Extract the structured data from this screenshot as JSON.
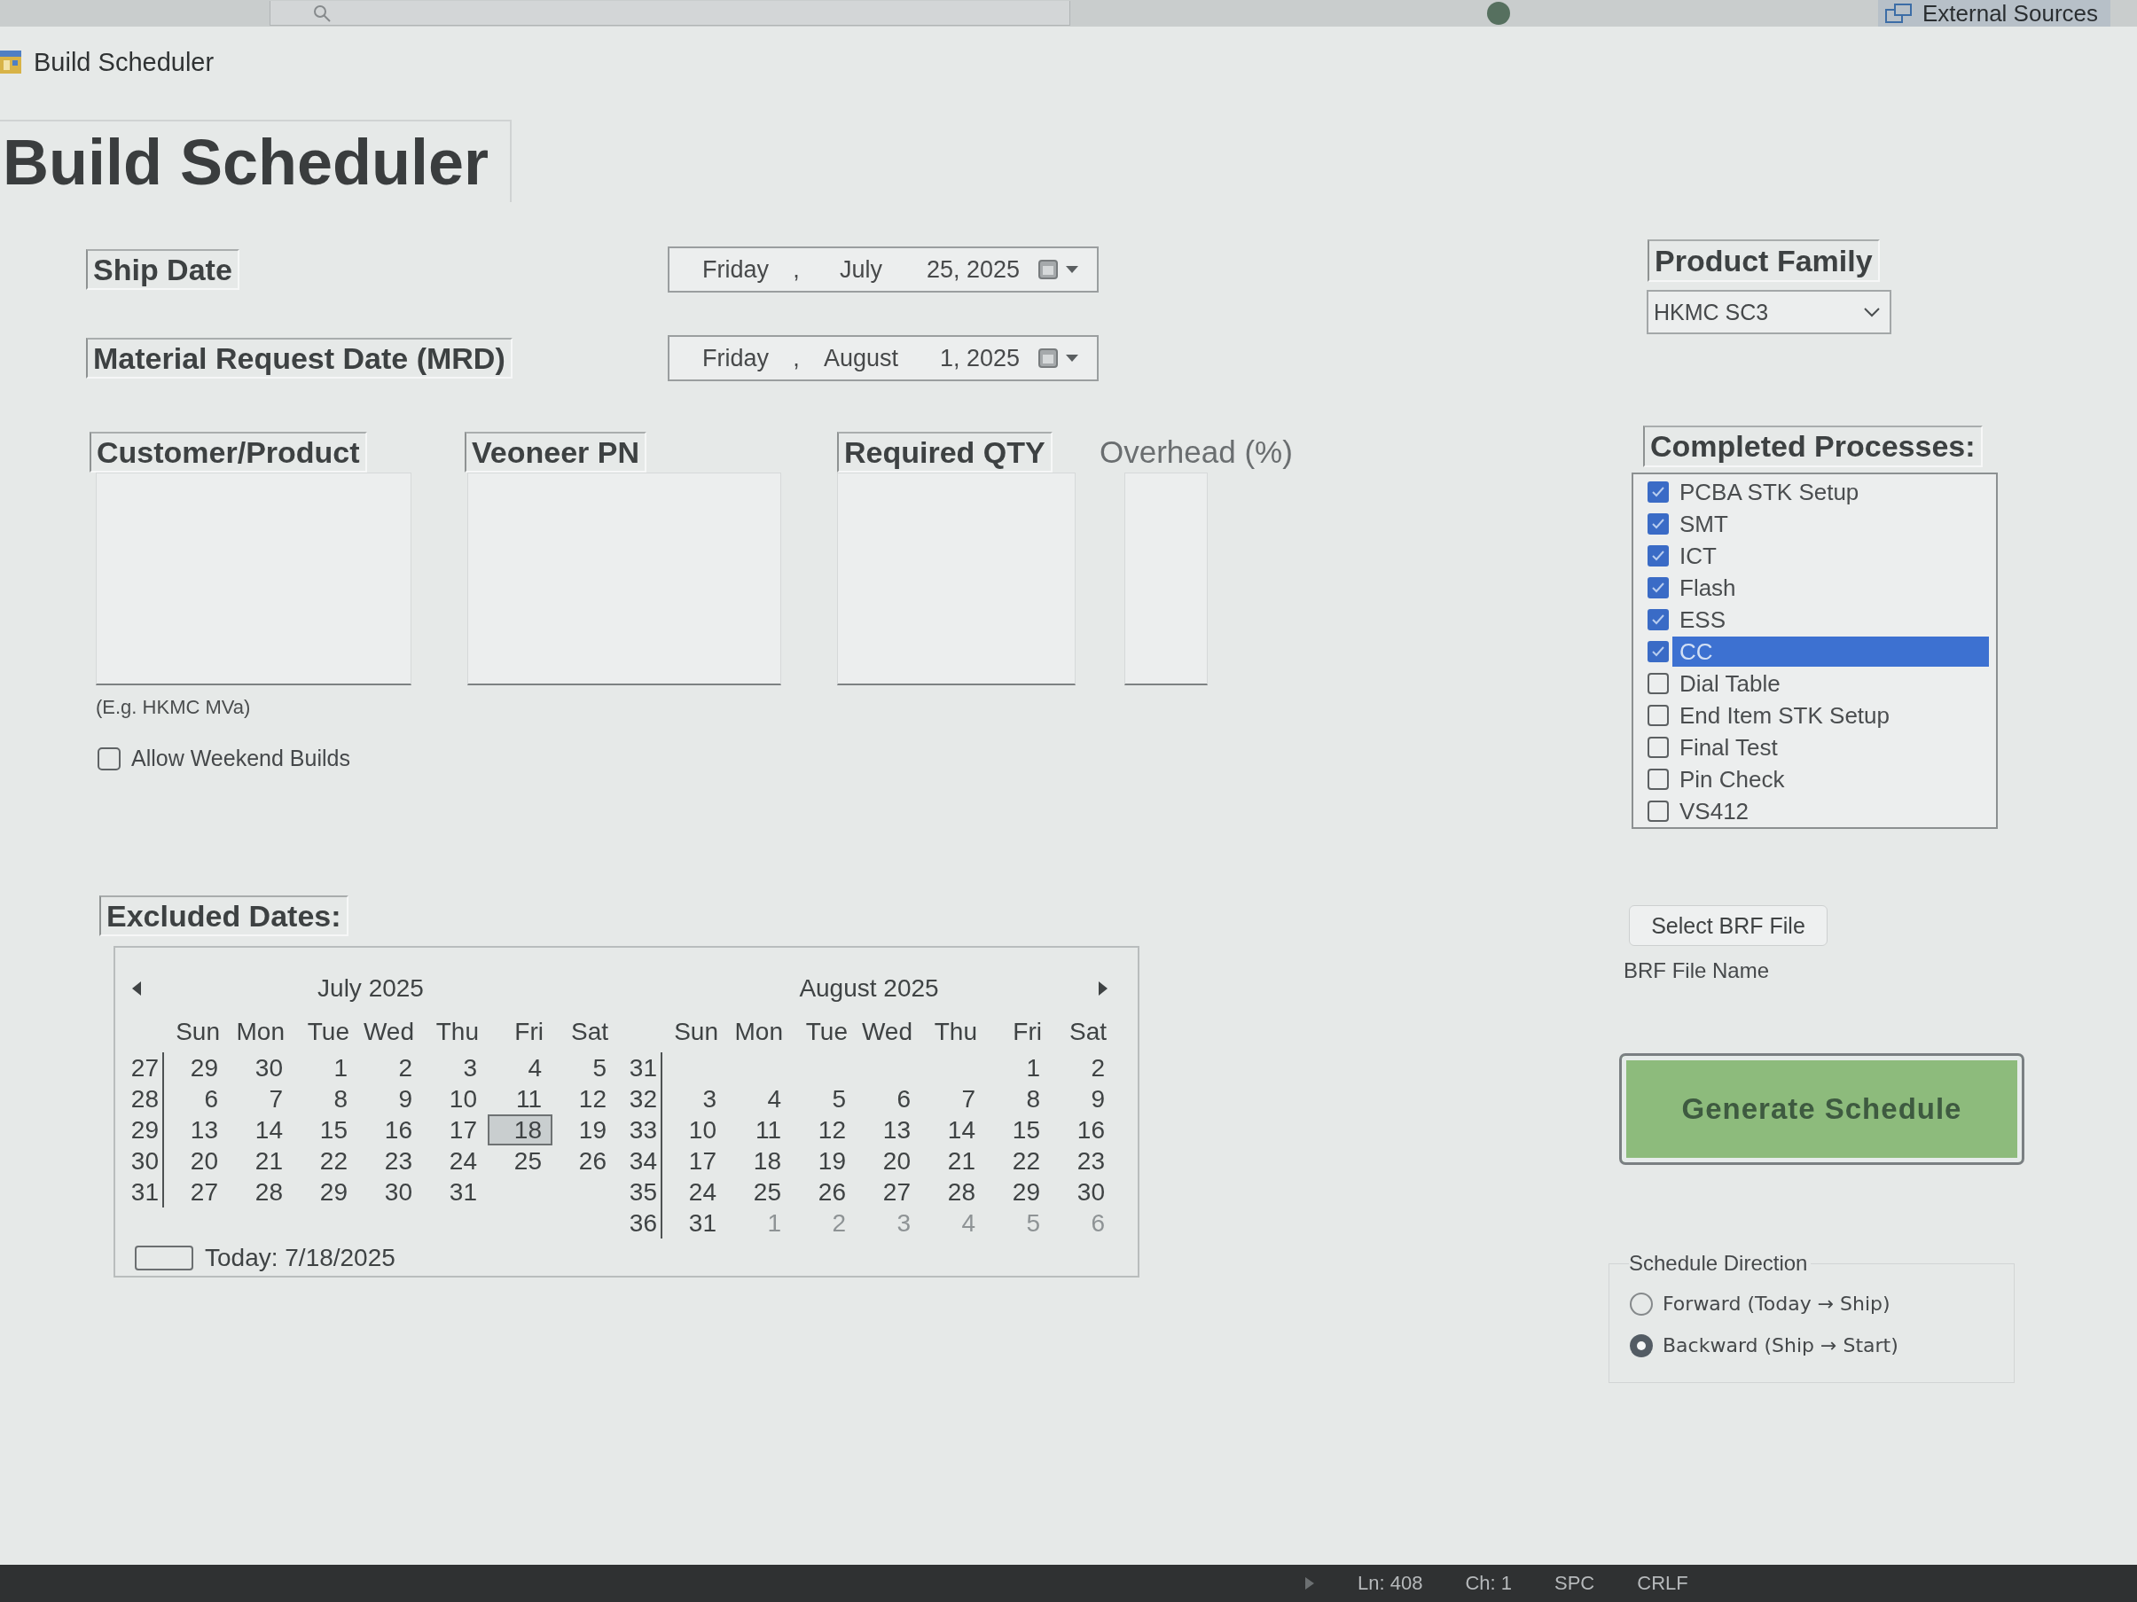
{
  "top_bar": {
    "tab": "External Sources"
  },
  "window": {
    "title": "Build Scheduler"
  },
  "heading": "Build Scheduler",
  "date_fields": [
    {
      "label": "Ship Date",
      "value_parts": [
        "Friday",
        ",",
        "July",
        "25, 2025"
      ]
    },
    {
      "label": "Material Request Date (MRD)",
      "value_parts": [
        "Friday",
        ",",
        "August",
        "1, 2025"
      ]
    }
  ],
  "text_inputs": [
    {
      "label": "Customer/Product",
      "kind": "framed"
    },
    {
      "label": "Veoneer PN",
      "kind": "framed"
    },
    {
      "label": "Required QTY",
      "kind": "framed"
    },
    {
      "label": "Overhead (%)",
      "kind": "plain"
    }
  ],
  "hint": "(E.g. HKMC MVa)",
  "allow_weekend": {
    "label": "Allow Weekend Builds",
    "checked": false
  },
  "excluded_dates": {
    "label": "Excluded Dates:",
    "months": [
      {
        "title": "July 2025",
        "weekdays": [
          "Sun",
          "Mon",
          "Tue",
          "Wed",
          "Thu",
          "Fri",
          "Sat"
        ],
        "weeks": [
          {
            "number": "27",
            "days": [
              {
                "day": "29",
                "adjacent": false,
                "selected": false
              },
              {
                "day": "30",
                "adjacent": false,
                "selected": false
              },
              {
                "day": "1",
                "adjacent": false,
                "selected": false
              },
              {
                "day": "2",
                "adjacent": false,
                "selected": false
              },
              {
                "day": "3",
                "adjacent": false,
                "selected": false
              },
              {
                "day": "4",
                "adjacent": false,
                "selected": false
              },
              {
                "day": "5",
                "adjacent": false,
                "selected": false
              }
            ]
          },
          {
            "number": "28",
            "days": [
              {
                "day": "6",
                "adjacent": false,
                "selected": false
              },
              {
                "day": "7",
                "adjacent": false,
                "selected": false
              },
              {
                "day": "8",
                "adjacent": false,
                "selected": false
              },
              {
                "day": "9",
                "adjacent": false,
                "selected": false
              },
              {
                "day": "10",
                "adjacent": false,
                "selected": false
              },
              {
                "day": "11",
                "adjacent": false,
                "selected": false
              },
              {
                "day": "12",
                "adjacent": false,
                "selected": false
              }
            ]
          },
          {
            "number": "29",
            "days": [
              {
                "day": "13",
                "adjacent": false,
                "selected": false
              },
              {
                "day": "14",
                "adjacent": false,
                "selected": false
              },
              {
                "day": "15",
                "adjacent": false,
                "selected": false
              },
              {
                "day": "16",
                "adjacent": false,
                "selected": false
              },
              {
                "day": "17",
                "adjacent": false,
                "selected": false
              },
              {
                "day": "18",
                "adjacent": false,
                "selected": true
              },
              {
                "day": "19",
                "adjacent": false,
                "selected": false
              }
            ]
          },
          {
            "number": "30",
            "days": [
              {
                "day": "20",
                "adjacent": false,
                "selected": false
              },
              {
                "day": "21",
                "adjacent": false,
                "selected": false
              },
              {
                "day": "22",
                "adjacent": false,
                "selected": false
              },
              {
                "day": "23",
                "adjacent": false,
                "selected": false
              },
              {
                "day": "24",
                "adjacent": false,
                "selected": false
              },
              {
                "day": "25",
                "adjacent": false,
                "selected": false
              },
              {
                "day": "26",
                "adjacent": false,
                "selected": false
              }
            ]
          },
          {
            "number": "31",
            "days": [
              {
                "day": "27",
                "adjacent": false,
                "selected": false
              },
              {
                "day": "28",
                "adjacent": false,
                "selected": false
              },
              {
                "day": "29",
                "adjacent": false,
                "selected": false
              },
              {
                "day": "30",
                "adjacent": false,
                "selected": false
              },
              {
                "day": "31",
                "adjacent": false,
                "selected": false
              }
            ]
          }
        ]
      },
      {
        "title": "August 2025",
        "weekdays": [
          "Sun",
          "Mon",
          "Tue",
          "Wed",
          "Thu",
          "Fri",
          "Sat"
        ],
        "weeks": [
          {
            "number": "31",
            "days": [
              {
                "day": "1",
                "adjacent": false,
                "selected": false
              },
              {
                "day": "2",
                "adjacent": false,
                "selected": false
              }
            ]
          },
          {
            "number": "32",
            "days": [
              {
                "day": "3",
                "adjacent": false,
                "selected": false
              },
              {
                "day": "4",
                "adjacent": false,
                "selected": false
              },
              {
                "day": "5",
                "adjacent": false,
                "selected": false
              },
              {
                "day": "6",
                "adjacent": false,
                "selected": false
              },
              {
                "day": "7",
                "adjacent": false,
                "selected": false
              },
              {
                "day": "8",
                "adjacent": false,
                "selected": false
              },
              {
                "day": "9",
                "adjacent": false,
                "selected": false
              }
            ]
          },
          {
            "number": "33",
            "days": [
              {
                "day": "10",
                "adjacent": false,
                "selected": false
              },
              {
                "day": "11",
                "adjacent": false,
                "selected": false
              },
              {
                "day": "12",
                "adjacent": false,
                "selected": false
              },
              {
                "day": "13",
                "adjacent": false,
                "selected": false
              },
              {
                "day": "14",
                "adjacent": false,
                "selected": false
              },
              {
                "day": "15",
                "adjacent": false,
                "selected": false
              },
              {
                "day": "16",
                "adjacent": false,
                "selected": false
              }
            ]
          },
          {
            "number": "34",
            "days": [
              {
                "day": "17",
                "adjacent": false,
                "selected": false
              },
              {
                "day": "18",
                "adjacent": false,
                "selected": false
              },
              {
                "day": "19",
                "adjacent": false,
                "selected": false
              },
              {
                "day": "20",
                "adjacent": false,
                "selected": false
              },
              {
                "day": "21",
                "adjacent": false,
                "selected": false
              },
              {
                "day": "22",
                "adjacent": false,
                "selected": false
              },
              {
                "day": "23",
                "adjacent": false,
                "selected": false
              }
            ]
          },
          {
            "number": "35",
            "days": [
              {
                "day": "24",
                "adjacent": false,
                "selected": false
              },
              {
                "day": "25",
                "adjacent": false,
                "selected": false
              },
              {
                "day": "26",
                "adjacent": false,
                "selected": false
              },
              {
                "day": "27",
                "adjacent": false,
                "selected": false
              },
              {
                "day": "28",
                "adjacent": false,
                "selected": false
              },
              {
                "day": "29",
                "adjacent": false,
                "selected": false
              },
              {
                "day": "30",
                "adjacent": false,
                "selected": false
              }
            ]
          },
          {
            "number": "36",
            "days": [
              {
                "day": "31",
                "adjacent": false,
                "selected": false
              },
              {
                "day": "1",
                "adjacent": true,
                "selected": false
              },
              {
                "day": "2",
                "adjacent": true,
                "selected": false
              },
              {
                "day": "3",
                "adjacent": true,
                "selected": false
              },
              {
                "day": "4",
                "adjacent": true,
                "selected": false
              },
              {
                "day": "5",
                "adjacent": true,
                "selected": false
              },
              {
                "day": "6",
                "adjacent": true,
                "selected": false
              }
            ]
          }
        ]
      }
    ],
    "today": "Today: 7/18/2025"
  },
  "product_family": {
    "label": "Product Family",
    "value": "HKMC SC3"
  },
  "completed_processes": {
    "label": "Completed Processes:",
    "items": [
      {
        "label": "PCBA STK Setup",
        "checked": true,
        "selected": false
      },
      {
        "label": "SMT",
        "checked": true,
        "selected": false
      },
      {
        "label": "ICT",
        "checked": true,
        "selected": false
      },
      {
        "label": "Flash",
        "checked": true,
        "selected": false
      },
      {
        "label": "ESS",
        "checked": true,
        "selected": false
      },
      {
        "label": "CC",
        "checked": true,
        "selected": true
      },
      {
        "label": "Dial Table",
        "checked": false,
        "selected": false
      },
      {
        "label": "End Item STK Setup",
        "checked": false,
        "selected": false
      },
      {
        "label": "Final Test",
        "checked": false,
        "selected": false
      },
      {
        "label": "Pin Check",
        "checked": false,
        "selected": false
      },
      {
        "label": "VS412",
        "checked": false,
        "selected": false
      }
    ]
  },
  "brf": {
    "button": "Select BRF File",
    "file_name": "BRF File Name"
  },
  "generate_button": "Generate Schedule",
  "schedule_direction": {
    "title": "Schedule Direction",
    "options": [
      {
        "label": "Forward (Today → Ship)",
        "selected": false
      },
      {
        "label": "Backward (Ship → Start)",
        "selected": true
      }
    ]
  },
  "status_bar": [
    "Ln: 408",
    "Ch: 1",
    "SPC",
    "CRLF"
  ]
}
